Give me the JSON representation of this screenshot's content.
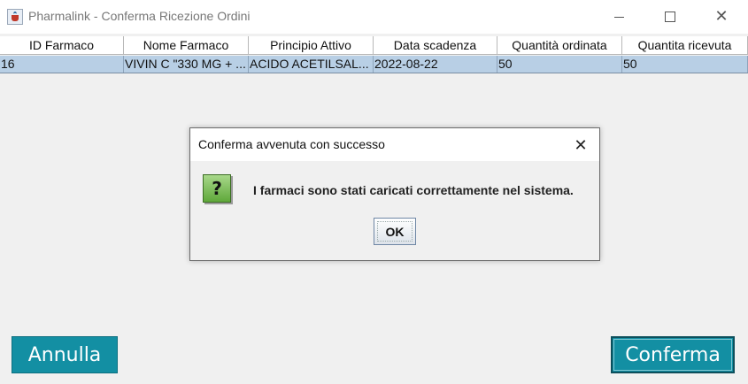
{
  "window": {
    "title": "Pharmalink - Conferma Ricezione Ordini",
    "controls": {
      "minimize": "minimize-icon",
      "maximize": "maximize-icon",
      "close": "close-icon"
    }
  },
  "table": {
    "columns": [
      "ID Farmaco",
      "Nome Farmaco",
      "Principio Attivo",
      "Data scadenza",
      "Quantità ordinata",
      "Quantita ricevuta"
    ],
    "rows": [
      [
        "16",
        "VIVIN C \"330 MG + ...",
        "ACIDO ACETILSAL...",
        "2022-08-22",
        "50",
        "50"
      ]
    ],
    "selected_row_color": "#b8cfe5"
  },
  "dialog": {
    "title": "Conferma avvenuta con successo",
    "icon": "question-icon",
    "icon_glyph": "?",
    "message": "I farmaci sono stati caricati correttamente nel sistema.",
    "ok_label": "OK"
  },
  "buttons": {
    "cancel_label": "Annulla",
    "confirm_label": "Conferma",
    "accent_color": "#138fa3"
  }
}
